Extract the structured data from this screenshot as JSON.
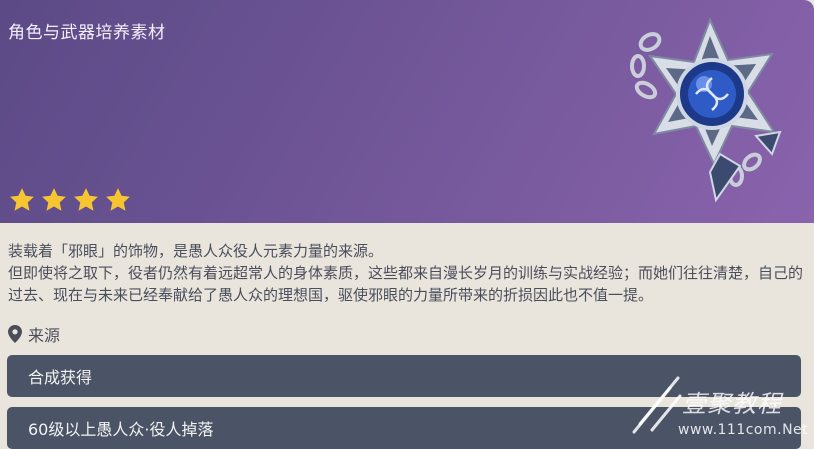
{
  "header": {
    "category": "角色与武器培养素材",
    "rarity": 4,
    "stars": [
      "star",
      "star",
      "star",
      "star"
    ]
  },
  "description": {
    "line1": "装载着「邪眼」的饰物，是愚人众役人元素力量的来源。",
    "line2": "但即使将之取下，役者仍然有着远超常人的身体素质，这些都来自漫长岁月的训练与实战经验；而她们往往清楚，自己的过去、现在与未来已经奉献给了愚人众的理想国，驱使邪眼的力量所带来的折损因此也不值一提。"
  },
  "source": {
    "heading": "来源",
    "icon": "location-pin-icon",
    "items": [
      "合成获得",
      "60级以上愚人众·役人掉落"
    ]
  },
  "watermark": {
    "title": "壹聚教程",
    "url": "www.111com.Net"
  },
  "colors": {
    "banner_start": "#5b4a86",
    "banner_end": "#8a63ad",
    "star": "#f7c531",
    "source_button": "#4b5466",
    "page_bg": "#e9e5dd"
  }
}
